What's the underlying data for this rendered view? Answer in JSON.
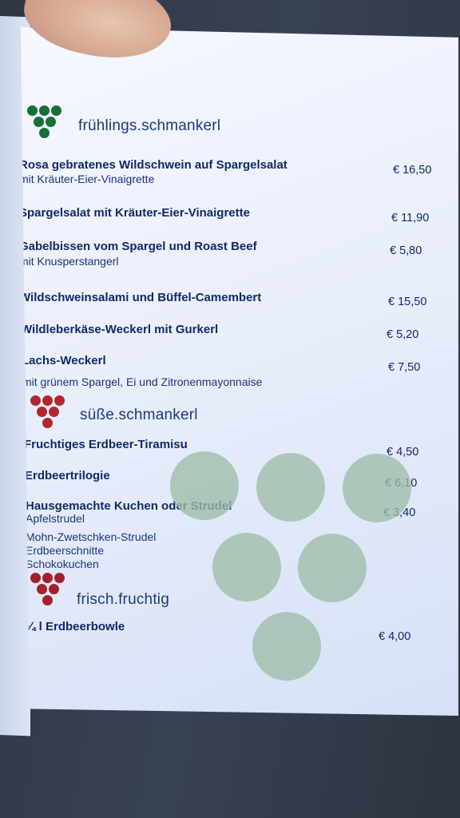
{
  "menu": {
    "sections": [
      {
        "title": "frühlings.schmankerl",
        "grape_color": "#17703a",
        "items": [
          {
            "name": "Rosa gebratenes Wildschwein auf Spargelsalat",
            "sub": "mit Kräuter-Eier-Vinaigrette",
            "price": "€ 16,50"
          },
          {
            "name": "Spargelsalat mit Kräuter-Eier-Vinaigrette",
            "price": "€ 11,90"
          },
          {
            "name": "Gabelbissen vom Spargel und Roast Beef",
            "sub": "mit Knusperstangerl",
            "price": "€ 5,80"
          },
          {
            "name": "Wildschweinsalami und Büffel-Camembert",
            "price": "€ 15,50"
          },
          {
            "name": "Wildleberkäse-Weckerl mit Gurkerl",
            "price": "€ 5,20"
          },
          {
            "name": "Lachs-Weckerl",
            "sub": "mit grünem Spargel, Ei und Zitronenmayonnaise",
            "price": "€ 7,50"
          }
        ]
      },
      {
        "title": "süße.schmankerl",
        "grape_color": "#b3262c",
        "items": [
          {
            "name": "Fruchtiges Erdbeer-Tiramisu",
            "price": "€ 4,50"
          },
          {
            "name": "Erdbeertrilogie",
            "price": "€ 6,10"
          },
          {
            "name": "Hausgemachte Kuchen oder Strudel",
            "subs": [
              "Apfelstrudel",
              "Mohn-Zwetschken-Strudel",
              "Erdbeerschnitte",
              "Schokokuchen"
            ],
            "price": "€ 3,40"
          }
        ]
      },
      {
        "title": "frisch.fruchtig",
        "grape_color": "#a3222a",
        "items": [
          {
            "name": "¼ l Erdbeerbowle",
            "price": "€ 4,00"
          }
        ]
      }
    ],
    "watermark_color": "#9ebca8"
  }
}
